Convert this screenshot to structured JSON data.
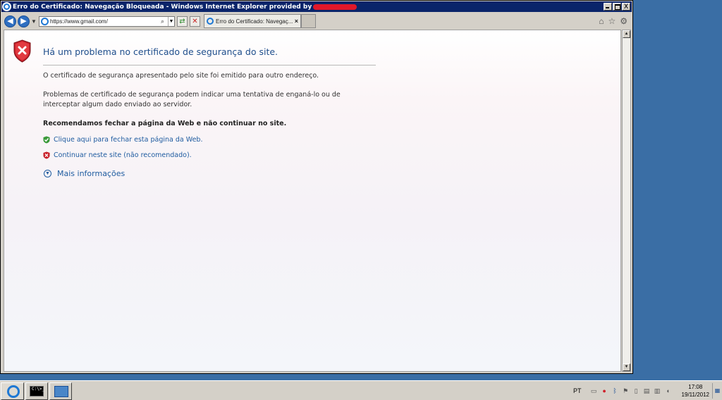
{
  "window": {
    "title": "Erro do Certificado: Navegação Bloqueada - Windows Internet Explorer provided by",
    "close_glyph": "X"
  },
  "navbar": {
    "url": "https://www.gmail.com/",
    "tab_label": "Erro do Certificado: Navegaç...",
    "tab_close": "×",
    "search_glyph": "⌕",
    "dropdown_glyph": "▼",
    "refresh_glyph": "⇄",
    "stop_glyph": "✕",
    "home_glyph": "⌂",
    "favorites_glyph": "☆",
    "tools_glyph": "⚙"
  },
  "page": {
    "title": "Há um problema no certificado de segurança do site.",
    "paragraph1": "O certificado de segurança apresentado pelo site foi emitido para outro endereço.",
    "paragraph2": "Problemas de certificado de segurança podem indicar uma tentativa de enganá-lo ou de interceptar algum dado enviado ao servidor.",
    "recommendation": "Recomendamos fechar a página da Web e não continuar no site.",
    "close_link": "Clique aqui para fechar esta página da Web.",
    "continue_link": "Continuar neste site (não recomendado).",
    "more_info": "Mais informações"
  },
  "icons": {
    "shield": "shield-error-icon",
    "shield_ok": "shield-ok-icon",
    "shield_error_small": "shield-error-small-icon",
    "chevron": "chevron-down-circle-icon"
  },
  "colors": {
    "title_blue": "#1f4e8c",
    "link_blue": "#1f5ca0",
    "shield_red": "#c8202a",
    "shield_green": "#3a9a3a",
    "desktop": "#3a6ea5",
    "titlebar": "#0a246a"
  },
  "taskbar": {
    "cmd_text": "C:\\>_",
    "language": "PT",
    "time": "17:08",
    "date": "19/11/2012"
  }
}
